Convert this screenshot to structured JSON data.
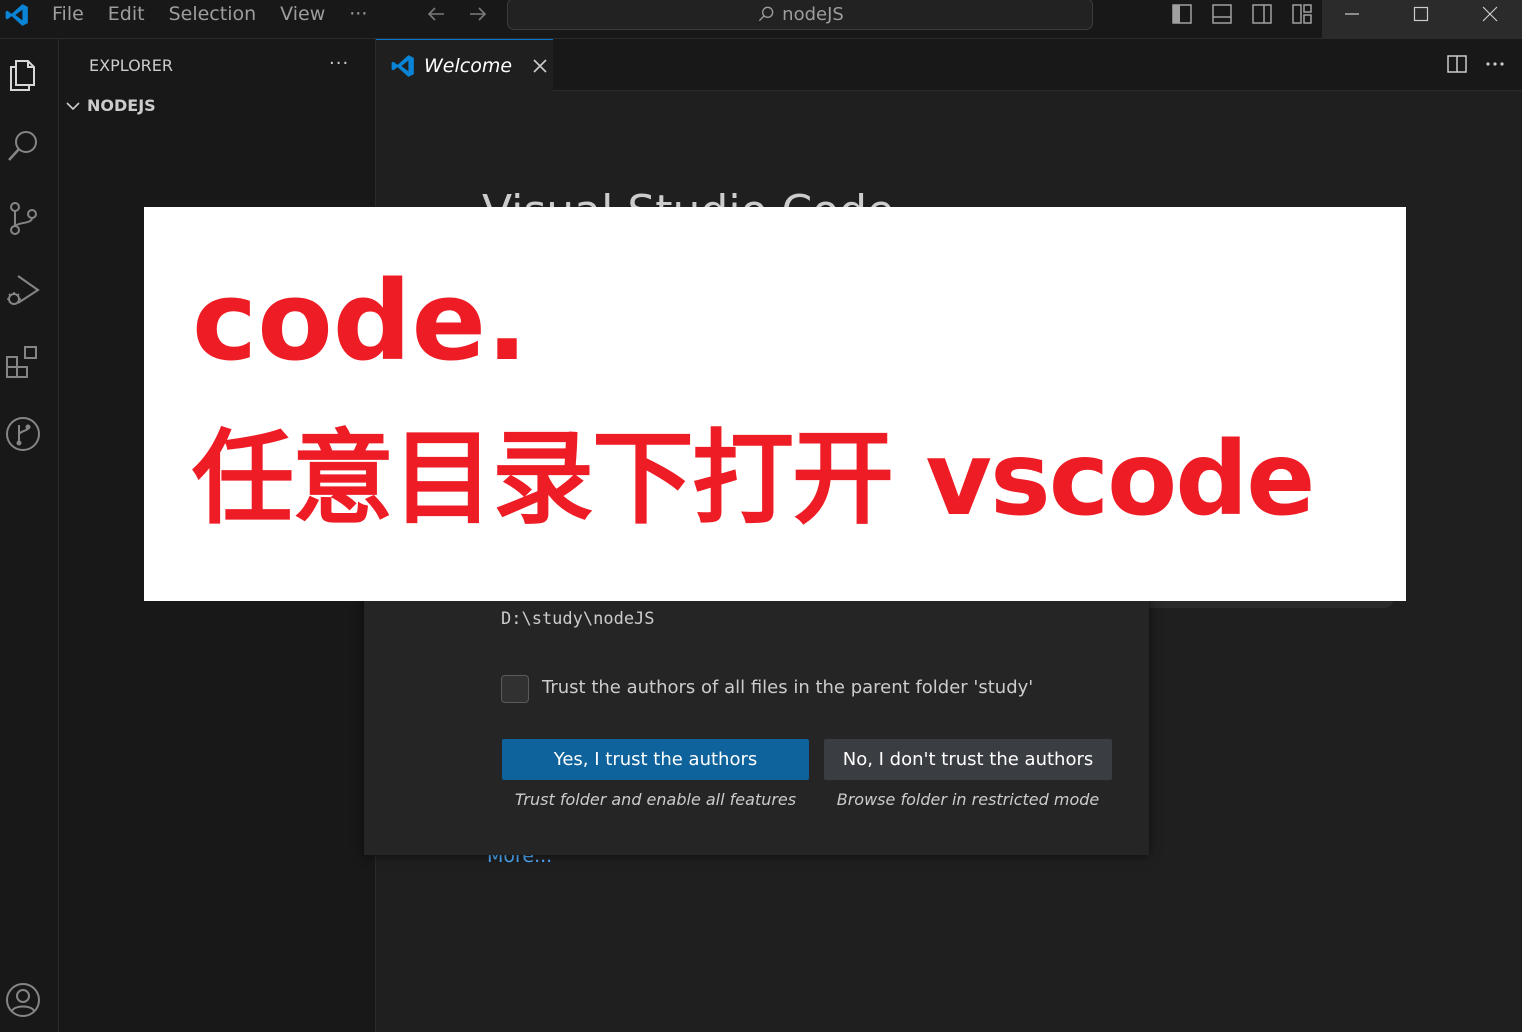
{
  "titlebar": {
    "menu": [
      "File",
      "Edit",
      "Selection",
      "View",
      "···"
    ],
    "search_text": "nodeJS"
  },
  "sidebar": {
    "title": "EXPLORER",
    "more": "···",
    "folder": "NODEJS"
  },
  "tab": {
    "label": "Welcome"
  },
  "editor": {
    "welcome_title": "Visual Studio Code",
    "more_link": "More..."
  },
  "dialog": {
    "path": "D:\\study\\nodeJS",
    "checkbox_label": "Trust the authors of all files in the parent folder 'study'",
    "yes_button": "Yes, I trust the authors",
    "yes_desc": "Trust folder and enable all features",
    "no_button": "No, I don't trust the authors",
    "no_desc": "Browse folder in restricted mode"
  },
  "banner": {
    "line1": "code.",
    "line2": "任意目录下打开 vscode"
  },
  "colors": {
    "accent": "#0078d4",
    "primary_button": "#0e639c",
    "banner_text": "#ee1c25"
  }
}
